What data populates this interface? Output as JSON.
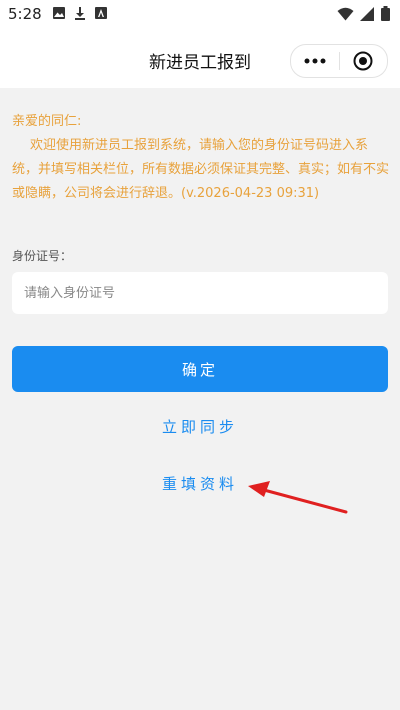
{
  "status_bar": {
    "time": "5:28",
    "left_icons": [
      "image-icon",
      "download-icon",
      "a-icon"
    ],
    "right_icons": [
      "wifi-icon",
      "signal-icon",
      "battery-icon"
    ]
  },
  "nav": {
    "title": "新进员工报到",
    "more_icon": "more-icon",
    "close_icon": "target-close-icon"
  },
  "notice": {
    "greeting": "亲爱的同仁:",
    "body": "欢迎使用新进员工报到系统，请输入您的身份证号码进入系统，并填写相关栏位，所有数据必须保证其完整、真实；如有不实或隐瞒，公司将会进行辞退。(v.2026-04-23 09:31)",
    "color": "#e8a23c"
  },
  "form": {
    "id_label": "身份证号：",
    "id_placeholder": "请输入身份证号",
    "id_value": "",
    "confirm_label": "确定"
  },
  "links": {
    "sync": "立即同步",
    "refill": "重填资料"
  },
  "colors": {
    "accent": "#1a8cf0",
    "background": "#f2f2f2",
    "annotation": "#e02020"
  }
}
